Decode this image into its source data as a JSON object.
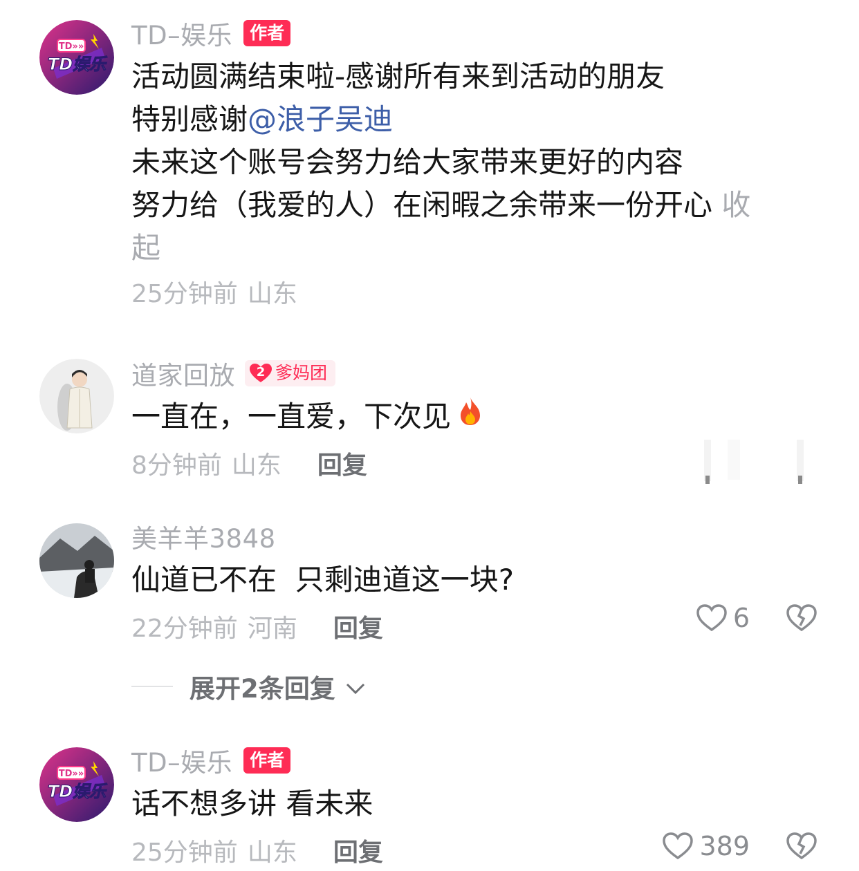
{
  "comments": [
    {
      "username": "TD–娱乐",
      "badge": "作者",
      "avatar_text": "TD娱乐",
      "avatar_small": "TD»»",
      "lines": [
        "活动圆满结束啦-感谢所有来到活动的朋友"
      ],
      "line2_prefix": "特别感谢",
      "mention": "@浪子吴迪",
      "line3": "未来这个账号会努力给大家带来更好的内容",
      "line4": "努力给（我爱的人）在闲暇之余带来一份开心",
      "collapse_1": "收",
      "collapse_2": "起",
      "time": "25分钟前",
      "location": "山东"
    },
    {
      "username": "道家回放",
      "fan_badge_level": "2",
      "fan_badge": "爹妈团",
      "text": "一直在，一直爱，下次见",
      "emoji": "fire-emoji",
      "time": "8分钟前",
      "location": "山东",
      "reply": "回复"
    },
    {
      "username": "美羊羊3848",
      "text": "仙道已不在  只剩迪道这一块?",
      "time": "22分钟前",
      "location": "河南",
      "reply": "回复",
      "likes": "6",
      "expand": "展开2条回复"
    },
    {
      "username": "TD–娱乐",
      "badge": "作者",
      "avatar_text": "TD娱乐",
      "avatar_small": "TD»»",
      "text": "话不想多讲 看未来",
      "time": "25分钟前",
      "location": "山东",
      "reply": "回复",
      "likes": "389"
    }
  ],
  "colors": {
    "accent": "#fe2c55",
    "mention": "#3d5ea8",
    "meta": "#b7b9bd",
    "avatar_bg": "#3a1e6e"
  }
}
